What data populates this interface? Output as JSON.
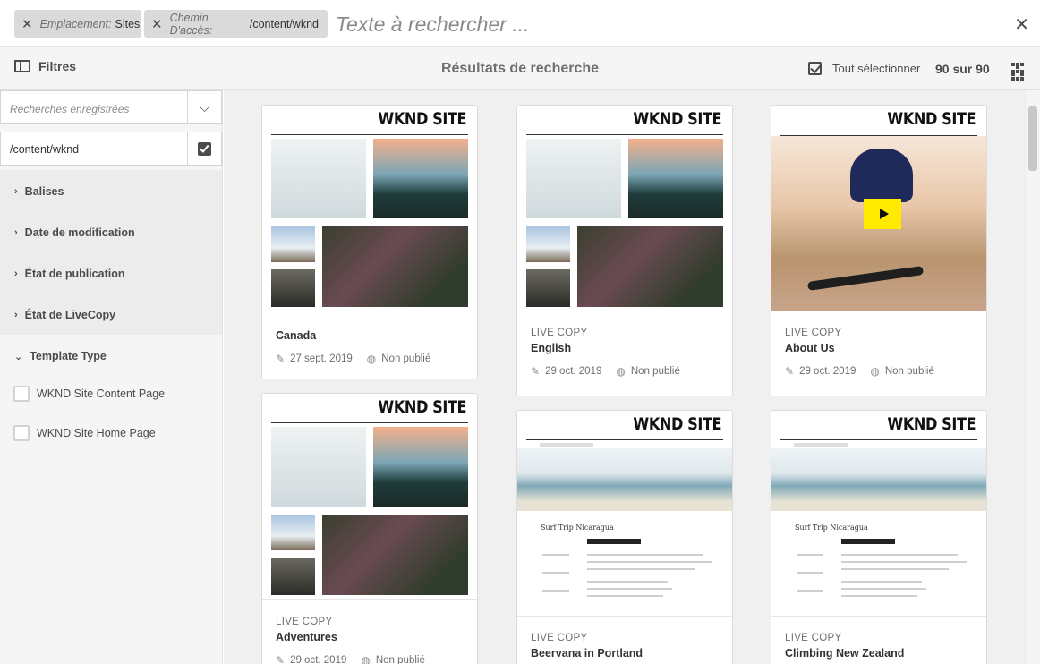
{
  "search": {
    "tags": [
      {
        "key": "Emplacement:",
        "value": "Sites"
      },
      {
        "key": "Chemin D'accès:",
        "value": "/content/wknd"
      }
    ],
    "placeholder": "Texte à rechercher ..."
  },
  "actionbar": {
    "filters_label": "Filtres",
    "title": "Résultats de recherche",
    "select_all": "Tout sélectionner",
    "count": "90 sur 90"
  },
  "sidebar": {
    "saved_placeholder": "Recherches enregistrées",
    "path_value": "/content/wknd",
    "accordions": [
      "Balises",
      "Date de modification",
      "État de publication",
      "État de LiveCopy",
      "Template Type"
    ],
    "template_options": [
      "WKND Site Content Page",
      "WKND Site Home Page"
    ]
  },
  "cards": [
    {
      "brand": "WKND SITE",
      "live": "",
      "title": "Canada",
      "date": "27 sept. 2019",
      "status": "Non publié"
    },
    {
      "brand": "WKND SITE",
      "live": "LIVE COPY",
      "title": "English",
      "date": "29 oct. 2019",
      "status": "Non publié"
    },
    {
      "brand": "WKND SITE",
      "live": "LIVE COPY",
      "title": "About Us",
      "date": "29 oct. 2019",
      "status": "Non publié"
    },
    {
      "brand": "WKND SITE",
      "live": "LIVE COPY",
      "title": "Adventures",
      "date": "29 oct. 2019",
      "status": "Non publié"
    },
    {
      "brand": "WKND SITE",
      "live": "LIVE COPY",
      "title": "Beervana in Portland",
      "date": "",
      "status": ""
    },
    {
      "brand": "WKND SITE",
      "live": "LIVE COPY",
      "title": "Climbing New Zealand",
      "date": "",
      "status": ""
    }
  ],
  "snippet": {
    "title": "Surf Trip Nicaragua"
  },
  "colors": {
    "accent_yellow": "#ffea00",
    "sidebar_bg": "#f5f5f5",
    "content_bg": "#f0f0f0"
  }
}
